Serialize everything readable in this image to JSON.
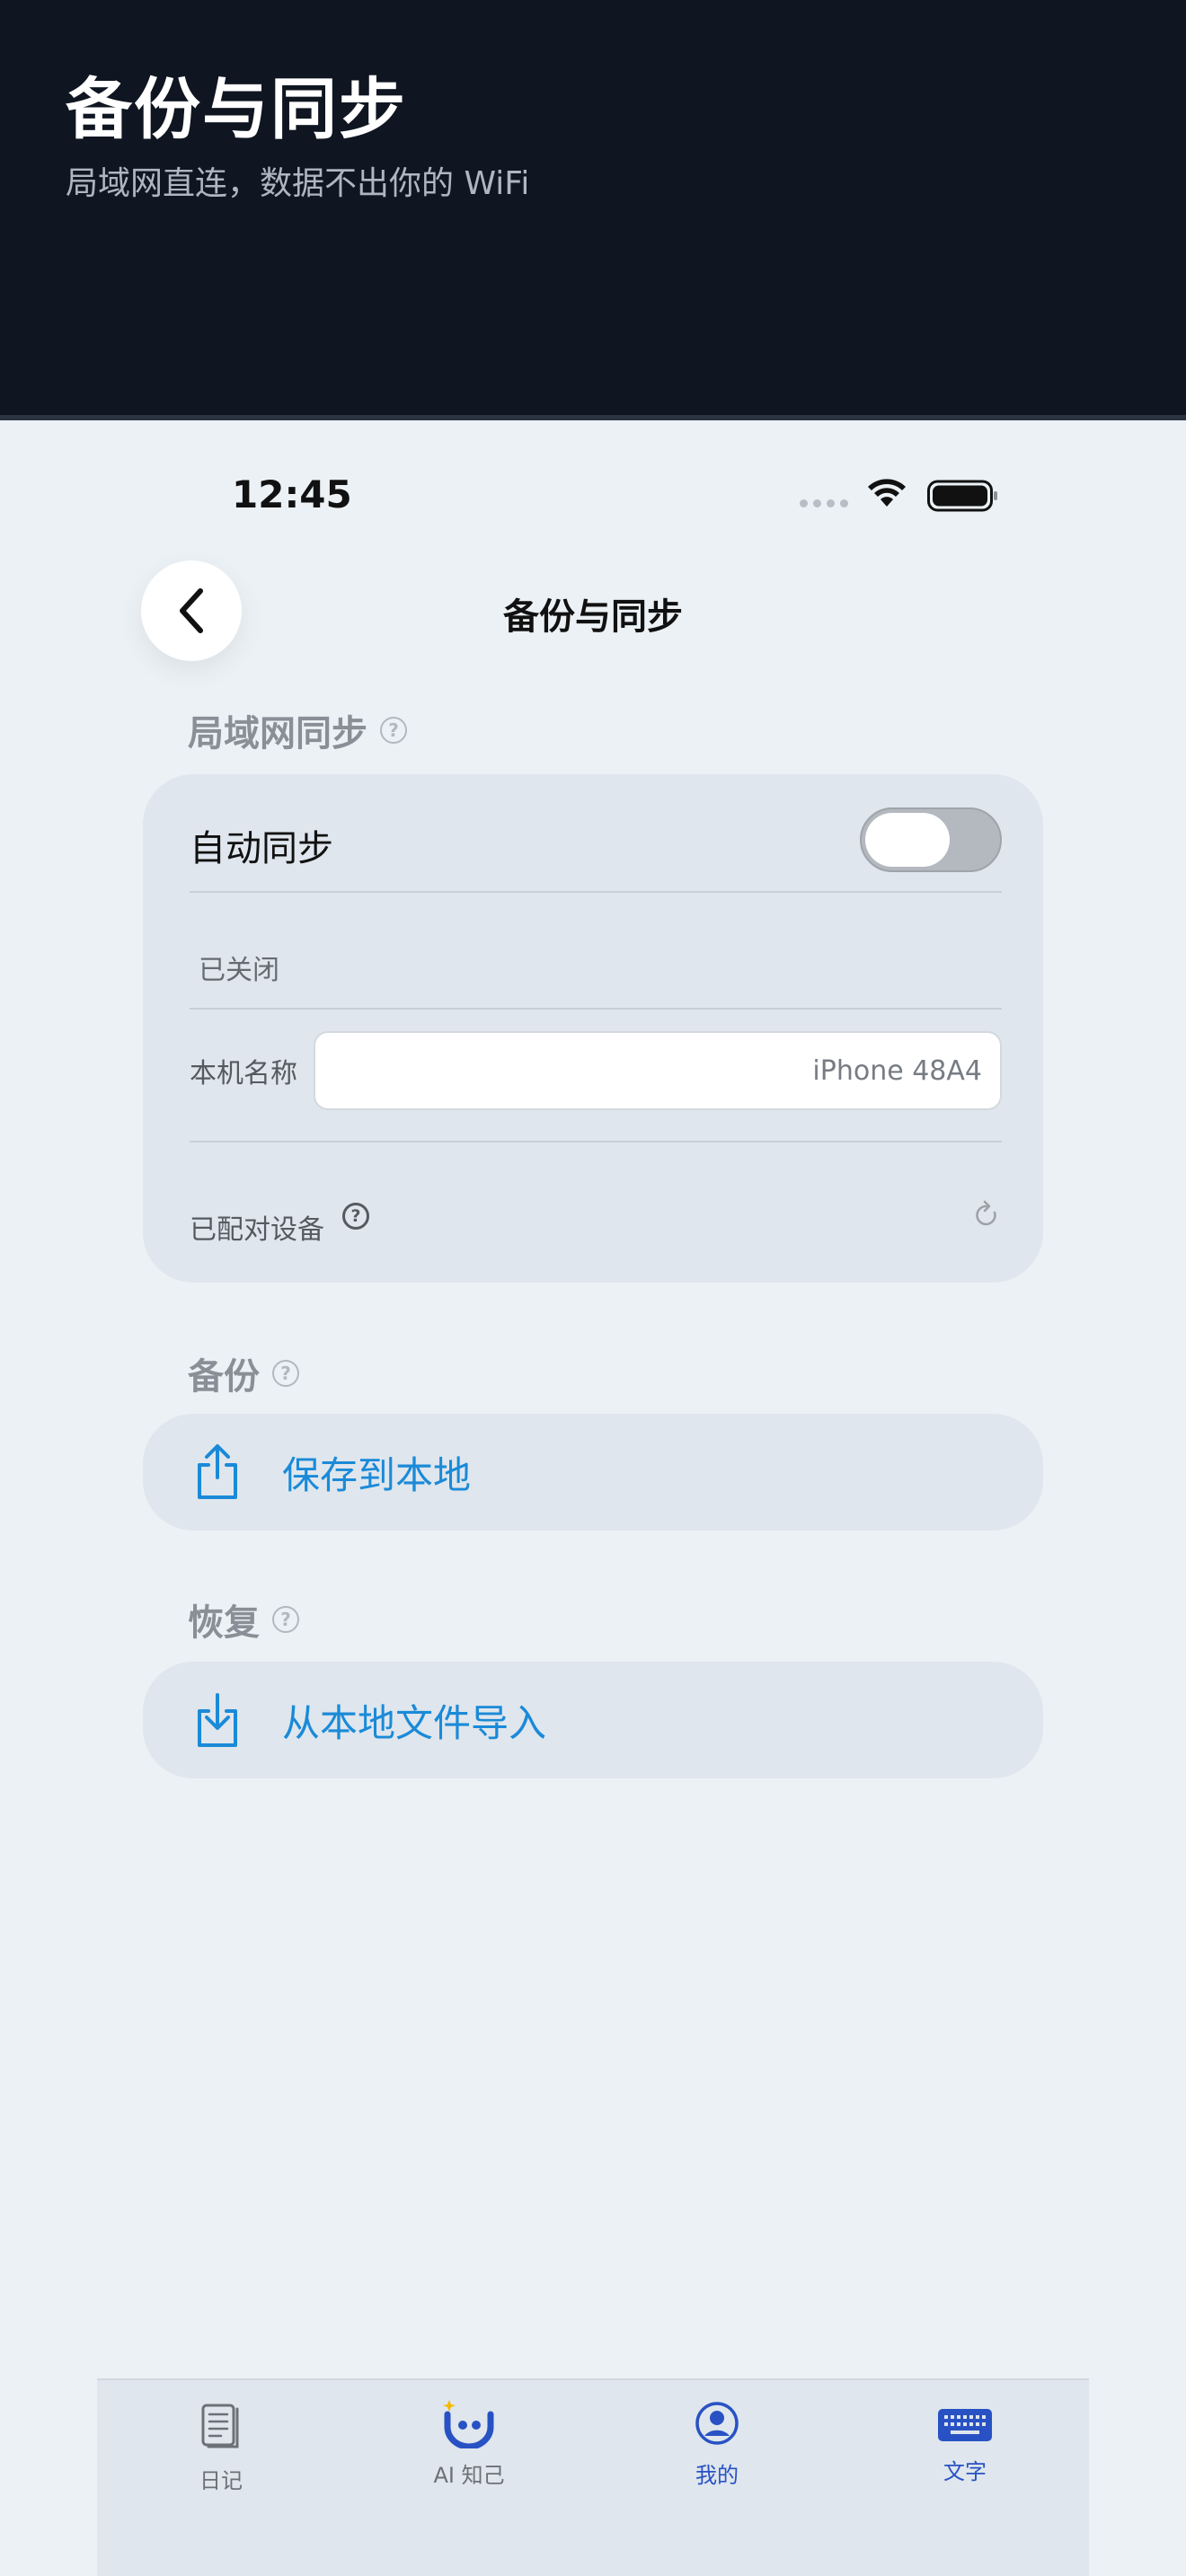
{
  "banner": {
    "title": "备份与同步",
    "subtitle": "局域网直连，数据不出你的 WiFi"
  },
  "status_bar": {
    "time": "12:45"
  },
  "nav": {
    "title": "备份与同步"
  },
  "lan_section": {
    "title": "局域网同步",
    "auto_sync_label": "自动同步",
    "auto_sync_on": false,
    "status_text": "已关闭",
    "device_name_label": "本机名称",
    "device_name_value": "iPhone 48A4",
    "paired_devices_label": "已配对设备"
  },
  "backup_section": {
    "title": "备份",
    "action_label": "保存到本地"
  },
  "restore_section": {
    "title": "恢复",
    "action_label": "从本地文件导入"
  },
  "tab_bar": {
    "items": [
      {
        "label": "日记",
        "icon": "diary-icon"
      },
      {
        "label": "AI 知己",
        "icon": "ai-face-icon"
      },
      {
        "label": "我的",
        "icon": "profile-icon"
      },
      {
        "label": "文字",
        "icon": "keyboard-icon"
      }
    ]
  },
  "colors": {
    "banner_bg": "#0f1621",
    "screen_bg": "#ecf1f5",
    "card_bg": "#dfe6ed",
    "accent_blue": "#1a8ad8",
    "tab_active": "#2852c4",
    "tab_inactive": "#6c7178"
  }
}
